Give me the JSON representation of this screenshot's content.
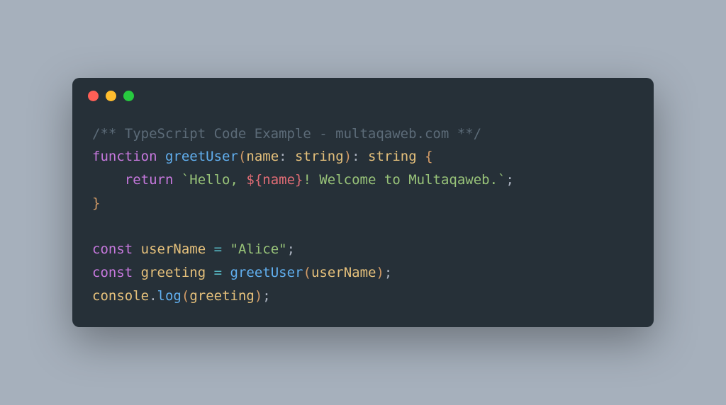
{
  "code": {
    "line1_comment": "/** TypeScript Code Example - multaqaweb.com **/",
    "line2": {
      "kw_function": "function",
      "fn_name": "greetUser",
      "paren_open": "(",
      "param": "name",
      "colon1": ":",
      "type1": "string",
      "paren_close": ")",
      "colon2": ":",
      "type2": "string",
      "brace_open": "{"
    },
    "line3": {
      "indent": "    ",
      "kw_return": "return",
      "str_open": "`Hello, ",
      "interp_open": "${",
      "interp_var": "name",
      "interp_close": "}",
      "str_rest": "! Welcome to Multaqaweb.`",
      "semi": ";"
    },
    "line4_brace": "}",
    "line5_blank": "",
    "line6": {
      "kw_const": "const",
      "var": "userName",
      "eq": "=",
      "str": "\"Alice\"",
      "semi": ";"
    },
    "line7": {
      "kw_const": "const",
      "var": "greeting",
      "eq": "=",
      "fn": "greetUser",
      "paren_open": "(",
      "arg": "userName",
      "paren_close": ")",
      "semi": ";"
    },
    "line8": {
      "obj": "console",
      "dot": ".",
      "method": "log",
      "paren_open": "(",
      "arg": "greeting",
      "paren_close": ")",
      "semi": ";"
    }
  }
}
